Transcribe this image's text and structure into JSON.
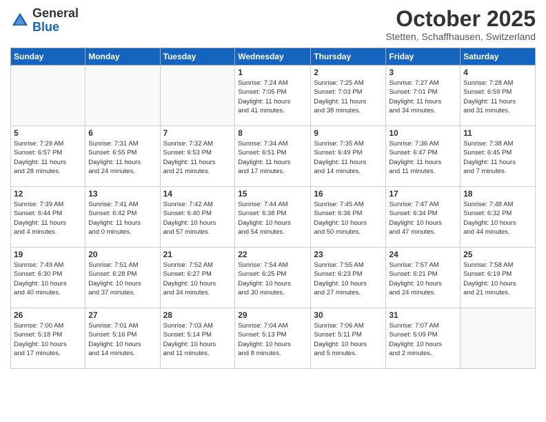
{
  "header": {
    "logo_general": "General",
    "logo_blue": "Blue",
    "month_title": "October 2025",
    "subtitle": "Stetten, Schaffhausen, Switzerland"
  },
  "days_of_week": [
    "Sunday",
    "Monday",
    "Tuesday",
    "Wednesday",
    "Thursday",
    "Friday",
    "Saturday"
  ],
  "weeks": [
    [
      {
        "day": "",
        "info": ""
      },
      {
        "day": "",
        "info": ""
      },
      {
        "day": "",
        "info": ""
      },
      {
        "day": "1",
        "info": "Sunrise: 7:24 AM\nSunset: 7:05 PM\nDaylight: 11 hours\nand 41 minutes."
      },
      {
        "day": "2",
        "info": "Sunrise: 7:25 AM\nSunset: 7:03 PM\nDaylight: 11 hours\nand 38 minutes."
      },
      {
        "day": "3",
        "info": "Sunrise: 7:27 AM\nSunset: 7:01 PM\nDaylight: 11 hours\nand 34 minutes."
      },
      {
        "day": "4",
        "info": "Sunrise: 7:28 AM\nSunset: 6:59 PM\nDaylight: 11 hours\nand 31 minutes."
      }
    ],
    [
      {
        "day": "5",
        "info": "Sunrise: 7:29 AM\nSunset: 6:57 PM\nDaylight: 11 hours\nand 28 minutes."
      },
      {
        "day": "6",
        "info": "Sunrise: 7:31 AM\nSunset: 6:55 PM\nDaylight: 11 hours\nand 24 minutes."
      },
      {
        "day": "7",
        "info": "Sunrise: 7:32 AM\nSunset: 6:53 PM\nDaylight: 11 hours\nand 21 minutes."
      },
      {
        "day": "8",
        "info": "Sunrise: 7:34 AM\nSunset: 6:51 PM\nDaylight: 11 hours\nand 17 minutes."
      },
      {
        "day": "9",
        "info": "Sunrise: 7:35 AM\nSunset: 6:49 PM\nDaylight: 11 hours\nand 14 minutes."
      },
      {
        "day": "10",
        "info": "Sunrise: 7:36 AM\nSunset: 6:47 PM\nDaylight: 11 hours\nand 11 minutes."
      },
      {
        "day": "11",
        "info": "Sunrise: 7:38 AM\nSunset: 6:45 PM\nDaylight: 11 hours\nand 7 minutes."
      }
    ],
    [
      {
        "day": "12",
        "info": "Sunrise: 7:39 AM\nSunset: 6:44 PM\nDaylight: 11 hours\nand 4 minutes."
      },
      {
        "day": "13",
        "info": "Sunrise: 7:41 AM\nSunset: 6:42 PM\nDaylight: 11 hours\nand 0 minutes."
      },
      {
        "day": "14",
        "info": "Sunrise: 7:42 AM\nSunset: 6:40 PM\nDaylight: 10 hours\nand 57 minutes."
      },
      {
        "day": "15",
        "info": "Sunrise: 7:44 AM\nSunset: 6:38 PM\nDaylight: 10 hours\nand 54 minutes."
      },
      {
        "day": "16",
        "info": "Sunrise: 7:45 AM\nSunset: 6:36 PM\nDaylight: 10 hours\nand 50 minutes."
      },
      {
        "day": "17",
        "info": "Sunrise: 7:47 AM\nSunset: 6:34 PM\nDaylight: 10 hours\nand 47 minutes."
      },
      {
        "day": "18",
        "info": "Sunrise: 7:48 AM\nSunset: 6:32 PM\nDaylight: 10 hours\nand 44 minutes."
      }
    ],
    [
      {
        "day": "19",
        "info": "Sunrise: 7:49 AM\nSunset: 6:30 PM\nDaylight: 10 hours\nand 40 minutes."
      },
      {
        "day": "20",
        "info": "Sunrise: 7:51 AM\nSunset: 6:28 PM\nDaylight: 10 hours\nand 37 minutes."
      },
      {
        "day": "21",
        "info": "Sunrise: 7:52 AM\nSunset: 6:27 PM\nDaylight: 10 hours\nand 34 minutes."
      },
      {
        "day": "22",
        "info": "Sunrise: 7:54 AM\nSunset: 6:25 PM\nDaylight: 10 hours\nand 30 minutes."
      },
      {
        "day": "23",
        "info": "Sunrise: 7:55 AM\nSunset: 6:23 PM\nDaylight: 10 hours\nand 27 minutes."
      },
      {
        "day": "24",
        "info": "Sunrise: 7:57 AM\nSunset: 6:21 PM\nDaylight: 10 hours\nand 24 minutes."
      },
      {
        "day": "25",
        "info": "Sunrise: 7:58 AM\nSunset: 6:19 PM\nDaylight: 10 hours\nand 21 minutes."
      }
    ],
    [
      {
        "day": "26",
        "info": "Sunrise: 7:00 AM\nSunset: 5:18 PM\nDaylight: 10 hours\nand 17 minutes."
      },
      {
        "day": "27",
        "info": "Sunrise: 7:01 AM\nSunset: 5:16 PM\nDaylight: 10 hours\nand 14 minutes."
      },
      {
        "day": "28",
        "info": "Sunrise: 7:03 AM\nSunset: 5:14 PM\nDaylight: 10 hours\nand 11 minutes."
      },
      {
        "day": "29",
        "info": "Sunrise: 7:04 AM\nSunset: 5:13 PM\nDaylight: 10 hours\nand 8 minutes."
      },
      {
        "day": "30",
        "info": "Sunrise: 7:06 AM\nSunset: 5:11 PM\nDaylight: 10 hours\nand 5 minutes."
      },
      {
        "day": "31",
        "info": "Sunrise: 7:07 AM\nSunset: 5:09 PM\nDaylight: 10 hours\nand 2 minutes."
      },
      {
        "day": "",
        "info": ""
      }
    ]
  ]
}
